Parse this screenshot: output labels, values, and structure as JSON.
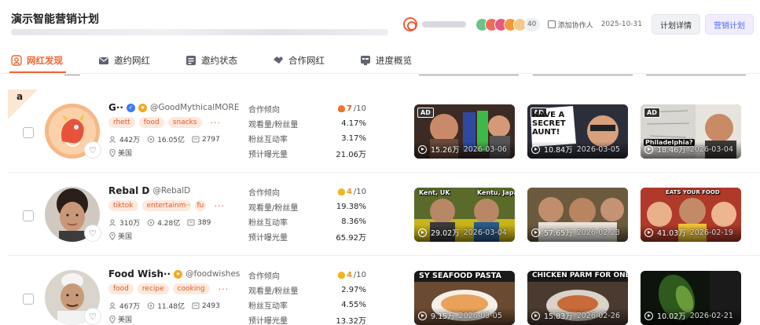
{
  "header": {
    "title": "演示智能营销计划",
    "collaborator_count": "40",
    "add_collaborator_label": "添加协作人",
    "date": "2025-10-31",
    "plan_detail_button": "计划详情",
    "marketing_plan_button": "营销计划",
    "collaborator_colors": [
      "#6cc48a",
      "#f06b5a",
      "#e85a7d",
      "#f29a3a",
      "#f4c98a"
    ]
  },
  "tabs": [
    {
      "label": "网红发现",
      "icon": "person-search-icon",
      "active": true
    },
    {
      "label": "邀约网红",
      "icon": "mail-icon",
      "active": false
    },
    {
      "label": "邀约状态",
      "icon": "status-list-icon",
      "active": false
    },
    {
      "label": "合作网红",
      "icon": "handshake-icon",
      "active": false
    },
    {
      "label": "进度概览",
      "icon": "progress-icon",
      "active": false
    }
  ],
  "metric_labels": {
    "intent": "合作倾向",
    "views_ratio": "观看量/粉丝量",
    "engagement": "粉丝互动率",
    "exposure": "预计曝光量"
  },
  "influencers": [
    {
      "corner_badge": "a",
      "name": "G··",
      "verified": true,
      "gold_badge": true,
      "handle": "@GoodMythicalMORE",
      "tags": [
        "rhett",
        "food",
        "snacks"
      ],
      "followers": "442万",
      "views": "16.05亿",
      "videos_count": "2797",
      "location": "美国",
      "intent_score": "7",
      "intent_max": "/10",
      "views_ratio": "4.17%",
      "engagement": "3.17%",
      "exposure": "21.06万",
      "avatar_color": "#f7b886",
      "videos": [
        {
          "views": "15.26万",
          "date": "2026-03-06",
          "ad": true,
          "caption": ""
        },
        {
          "views": "10.84万",
          "date": "2026-03-05",
          "ad": true,
          "caption": "HAVE A SECRET AUNT!"
        },
        {
          "views": "18.46万",
          "date": "2026-03-04",
          "ad": true,
          "caption": "Philadelphia?"
        }
      ]
    },
    {
      "corner_badge": "",
      "name": "Rebal D",
      "verified": false,
      "gold_badge": false,
      "handle": "@RebalD",
      "tags": [
        "tiktok",
        "entertainm···",
        "fu"
      ],
      "followers": "310万",
      "views": "4.28亿",
      "videos_count": "389",
      "location": "美国",
      "intent_score": "4",
      "intent_max": "/10",
      "views_ratio": "19.38%",
      "engagement": "8.36%",
      "exposure": "65.92万",
      "avatar_color": "#cfc9c2",
      "videos": [
        {
          "views": "29.02万",
          "date": "2026-03-04",
          "ad": false,
          "caption": "Kent, UK"
        },
        {
          "views": "57.65万",
          "date": "2026-02-23",
          "ad": false,
          "caption": ""
        },
        {
          "views": "41.03万",
          "date": "2026-02-19",
          "ad": false,
          "caption": "EATS YOUR FOOD"
        }
      ]
    },
    {
      "corner_badge": "",
      "name": "Food Wish··",
      "verified": false,
      "gold_badge": true,
      "handle": "@foodwishes",
      "tags": [
        "food",
        "recipe",
        "cooking"
      ],
      "followers": "467万",
      "views": "11.48亿",
      "videos_count": "2493",
      "location": "美国",
      "intent_score": "4",
      "intent_max": "/10",
      "views_ratio": "2.97%",
      "engagement": "4.55%",
      "exposure": "13.32万",
      "avatar_color": "#d9d4cc",
      "videos": [
        {
          "views": "9.15万",
          "date": "2026-03-05",
          "ad": false,
          "caption": "SY SEAFOOD PASTA"
        },
        {
          "views": "15.83万",
          "date": "2026-02-26",
          "ad": false,
          "caption": "CHICKEN PARM FOR ONE"
        },
        {
          "views": "10.02万",
          "date": "2026-02-21",
          "ad": false,
          "caption": ""
        }
      ]
    }
  ]
}
